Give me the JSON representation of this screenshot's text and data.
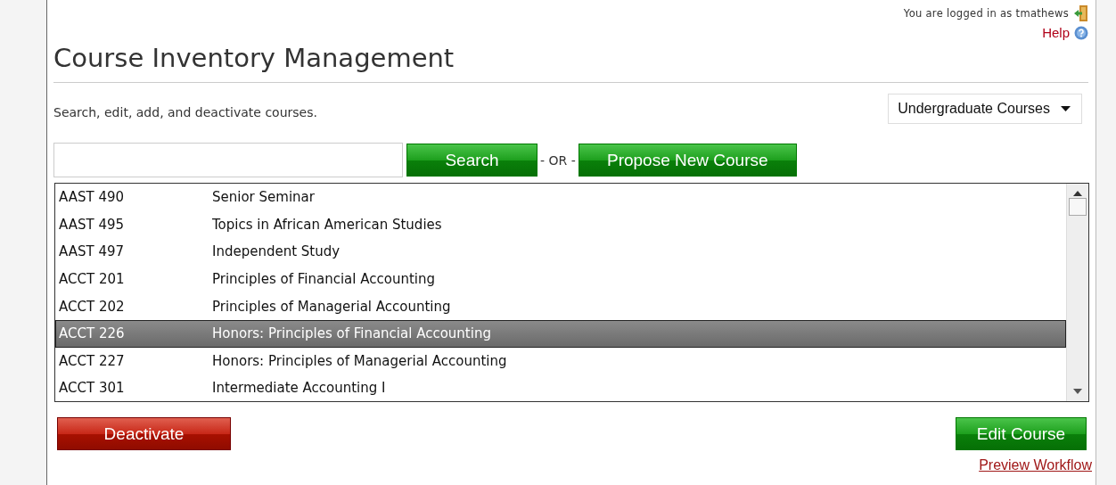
{
  "header": {
    "login_text": "You are logged in as tmathews",
    "help_link": "Help"
  },
  "title": "Course Inventory Management",
  "description": "Search, edit, add, and deactivate courses.",
  "course_level_select": {
    "value": "Undergraduate Courses"
  },
  "search": {
    "button": "Search",
    "separator": "- OR -",
    "propose_button": "Propose New Course"
  },
  "courses": [
    {
      "code": "AAST 490",
      "name": "Senior Seminar",
      "selected": false
    },
    {
      "code": "AAST 495",
      "name": "Topics in African American Studies",
      "selected": false
    },
    {
      "code": "AAST 497",
      "name": "Independent Study",
      "selected": false
    },
    {
      "code": "ACCT 201",
      "name": "Principles of Financial Accounting",
      "selected": false
    },
    {
      "code": "ACCT 202",
      "name": "Principles of Managerial Accounting",
      "selected": false
    },
    {
      "code": "ACCT 226",
      "name": "Honors: Principles of Financial Accounting",
      "selected": true
    },
    {
      "code": "ACCT 227",
      "name": "Honors: Principles of Managerial Accounting",
      "selected": false
    },
    {
      "code": "ACCT 301",
      "name": "Intermediate Accounting I",
      "selected": false
    }
  ],
  "actions": {
    "deactivate": "Deactivate",
    "edit": "Edit Course",
    "preview_link": "Preview Workflow"
  }
}
